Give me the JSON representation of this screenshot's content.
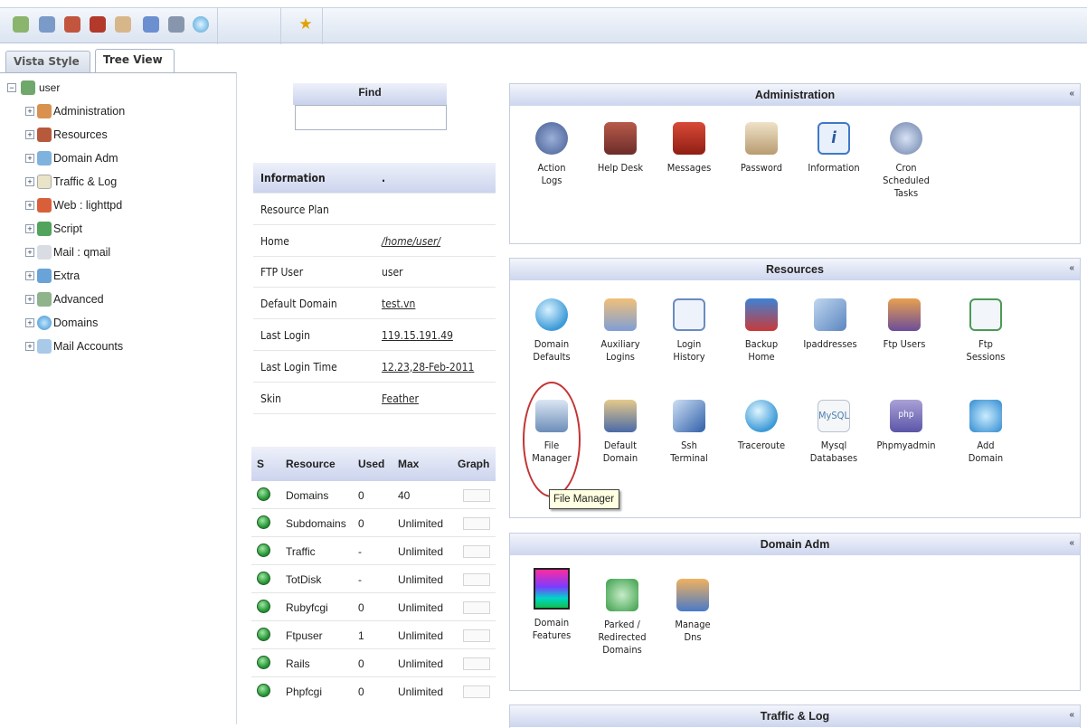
{
  "toolbar": {
    "icons": [
      "leaf-cog-icon",
      "tools-icon",
      "user-icon",
      "home-icon",
      "key-icon",
      "comment-icon",
      "gear-icon",
      "bubble-icon",
      "star-icon"
    ]
  },
  "tabs": [
    "Vista Style",
    "Tree View"
  ],
  "tree": {
    "root": "user",
    "items": [
      "Administration",
      "Resources",
      "Domain Adm",
      "Traffic & Log",
      "Web : lighttpd",
      "Script",
      "Mail : qmail",
      "Extra",
      "Advanced",
      "Domains",
      "Mail Accounts"
    ]
  },
  "find": {
    "label": "Find",
    "value": ""
  },
  "information": {
    "header_key": "Information",
    "header_val": ".",
    "rows": [
      {
        "k": "Resource Plan",
        "v": ""
      },
      {
        "k": "Home",
        "v": "/home/user/"
      },
      {
        "k": "FTP User",
        "v": "user"
      },
      {
        "k": "Default Domain",
        "v": "test.vn"
      },
      {
        "k": "Last Login",
        "v": "119.15.191.49"
      },
      {
        "k": "Last Login Time",
        "v": "12.23,28-Feb-2011"
      },
      {
        "k": "Skin",
        "v": "Feather"
      }
    ]
  },
  "resources_table": {
    "headers": [
      "S",
      "Resource",
      "Used",
      "Max",
      "Graph"
    ],
    "rows": [
      {
        "name": "Domains",
        "used": "0",
        "max": "40"
      },
      {
        "name": "Subdomains",
        "used": "0",
        "max": "Unlimited"
      },
      {
        "name": "Traffic",
        "used": "-",
        "max": "Unlimited"
      },
      {
        "name": "TotDisk",
        "used": "-",
        "max": "Unlimited"
      },
      {
        "name": "Rubyfcgi",
        "used": "0",
        "max": "Unlimited"
      },
      {
        "name": "Ftpuser",
        "used": "1",
        "max": "Unlimited"
      },
      {
        "name": "Rails",
        "used": "0",
        "max": "Unlimited"
      },
      {
        "name": "Phpfcgi",
        "used": "0",
        "max": "Unlimited"
      }
    ]
  },
  "panels": {
    "administration": {
      "title": "Administration",
      "items": [
        [
          "Action",
          "Logs"
        ],
        [
          "Help Desk"
        ],
        [
          "Messages"
        ],
        [
          "Password"
        ],
        [
          "Information"
        ],
        [
          "Cron",
          "Scheduled",
          "Tasks"
        ]
      ]
    },
    "resources": {
      "title": "Resources",
      "items": [
        [
          "Domain",
          "Defaults"
        ],
        [
          "Auxiliary",
          "Logins"
        ],
        [
          "Login",
          "History"
        ],
        [
          "Backup",
          "Home"
        ],
        [
          "Ipaddresses"
        ],
        [
          "Ftp Users"
        ],
        [
          "Ftp",
          "Sessions"
        ],
        [
          "File",
          "Manager"
        ],
        [
          "Default",
          "Domain"
        ],
        [
          "Ssh",
          "Terminal"
        ],
        [
          "Traceroute"
        ],
        [
          "Mysql",
          "Databases"
        ],
        [
          "Phpmyadmin"
        ],
        [
          "Add",
          "Domain"
        ]
      ]
    },
    "domain_adm": {
      "title": "Domain Adm",
      "items": [
        [
          "Domain",
          "Features"
        ],
        [
          "Parked /",
          "Redirected",
          "Domains"
        ],
        [
          "Manage",
          "Dns"
        ]
      ]
    },
    "traffic": {
      "title": "Traffic & Log"
    }
  },
  "tooltip": "File Manager",
  "collapse_glyph": "«"
}
